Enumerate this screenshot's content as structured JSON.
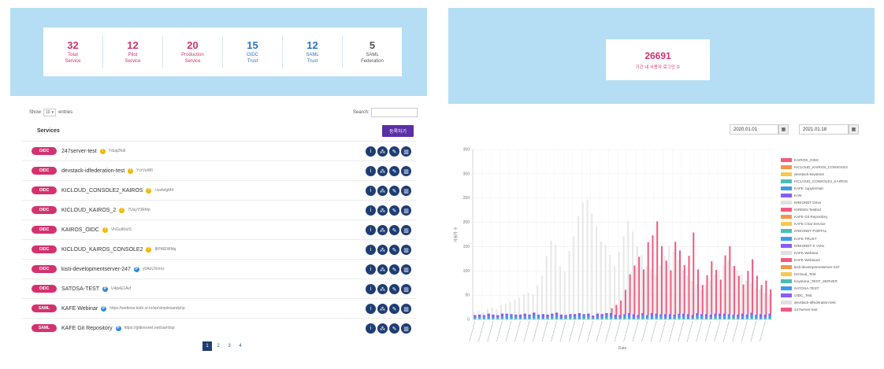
{
  "summary": {
    "stats": [
      {
        "value": "32",
        "line1": "Total",
        "line2": "Service",
        "color": "pink"
      },
      {
        "value": "12",
        "line1": "Pilot",
        "line2": "Service",
        "color": "pink"
      },
      {
        "value": "20",
        "line1": "Production",
        "line2": "Service",
        "color": "pink"
      },
      {
        "value": "15",
        "line1": "OIDC",
        "line2": "Trust",
        "color": "blue"
      },
      {
        "value": "12",
        "line1": "SAML",
        "line2": "Trust",
        "color": "blue"
      },
      {
        "value": "5",
        "line1": "SAML",
        "line2": "Federation",
        "color": "gray"
      }
    ]
  },
  "table": {
    "show_label": "Show",
    "entries_value": "10",
    "entries_label": "entries",
    "search_label": "Search:",
    "search_value": "",
    "header_label": "Services",
    "register_button": "등록하기",
    "rows": [
      {
        "type": "OIDC",
        "name": "247server-test",
        "status": "yellow",
        "id": "Yduq2Kdl"
      },
      {
        "type": "OIDC",
        "name": "devstack-idfederation-test",
        "status": "yellow",
        "id": "YcrVuWfi"
      },
      {
        "type": "OIDC",
        "name": "KICLOUD_CONSOLE2_KAIROS",
        "status": "yellow",
        "id": "l.wxfelgMrt"
      },
      {
        "type": "OIDC",
        "name": "KICLOUD_KAIROS_2",
        "status": "yellow",
        "id": "7UayY0Rhfp"
      },
      {
        "type": "OIDC",
        "name": "KAIROS_OIDC",
        "status": "yellow",
        "id": "VhGulKbzS"
      },
      {
        "type": "OIDC",
        "name": "KICLOUD_KAIROS_CONSOLE2",
        "status": "yellow",
        "id": "8iPWEWfdq"
      },
      {
        "type": "OIDC",
        "name": "kisti-developmentserver-247",
        "status": "blue",
        "id": "y0AeUXmnz"
      },
      {
        "type": "OIDC",
        "name": "SATOSA-TEST",
        "status": "blue",
        "id": "U4peE1Avf"
      },
      {
        "type": "SAML",
        "name": "KAFE Webinar",
        "status": "blue",
        "id": "https://webinar.kafe.or.kr/sp/simplesamlphp"
      },
      {
        "type": "SAML",
        "name": "KAFE Git Repository",
        "status": "blue",
        "id": "https://gitkreonet.net/saml/sp"
      }
    ],
    "pages": [
      "1",
      "2",
      "3",
      "4"
    ],
    "active_page": "1"
  },
  "login_summary": {
    "count": "26691",
    "label": "기간 내 사용자 로그인 수"
  },
  "date_range": {
    "start": "2020.01.01",
    "end": "2021.01.18"
  },
  "colors": {
    "pink": "#d4326f",
    "blue": "#2a73c9",
    "navy": "#1e3d73",
    "purple": "#5b2fa8",
    "panel": "#b5def4"
  },
  "chart_data": {
    "type": "bar",
    "stacked": true,
    "xlabel": "Date",
    "ylabel": "사용자 수",
    "ylim": [
      0,
      350
    ],
    "yticks": [
      0,
      50,
      100,
      150,
      200,
      250,
      300,
      350
    ],
    "grid": true,
    "legend_position": "right",
    "legend": [
      {
        "name": "KAIROS_OIDC",
        "color": "#f25a7f"
      },
      {
        "name": "KICLOUD_KAIROS_CONSOLE2",
        "color": "#f5954a"
      },
      {
        "name": "devstack-keystone",
        "color": "#f6c94e"
      },
      {
        "name": "KICLOUD_CONSOLE2_KAIROS",
        "color": "#4bbfb3"
      },
      {
        "name": "KAFE JupyterHub",
        "color": "#3d9be9"
      },
      {
        "name": "KAN",
        "color": "#8a5cf0"
      },
      {
        "name": "KREONET Drive",
        "color": "#e0e0e0"
      },
      {
        "name": "IOREEN Testbrd",
        "color": "#f25a7f"
      },
      {
        "name": "KAFE Git Repository",
        "color": "#f5954a"
      },
      {
        "name": "KAFE Chat Service",
        "color": "#f6c94e"
      },
      {
        "name": "KREONET PORTAL",
        "color": "#4bbfb3"
      },
      {
        "name": "KAFE TRUST",
        "color": "#3d9be9"
      },
      {
        "name": "KREONET-S VON",
        "color": "#8a5cf0"
      },
      {
        "name": "KAFE Webinar",
        "color": "#e0e0e0"
      },
      {
        "name": "KAFE Webinar2",
        "color": "#f25a7f"
      },
      {
        "name": "kisti-developmentserver-247",
        "color": "#f5954a"
      },
      {
        "name": "KICloud_Test",
        "color": "#f6c94e"
      },
      {
        "name": "Keystone_TEST_SERVER",
        "color": "#4bbfb3"
      },
      {
        "name": "SATOSA-TEST",
        "color": "#3d9be9"
      },
      {
        "name": "OIDC_Test",
        "color": "#8a5cf0"
      },
      {
        "name": "devstack-idfederation-test",
        "color": "#e0e0e0"
      },
      {
        "name": "247server-test",
        "color": "#f25a7f"
      }
    ],
    "series": [
      {
        "name": "KREONET Drive",
        "color": "#e6e6e6",
        "values": [
          5,
          8,
          6,
          10,
          15,
          12,
          18,
          20,
          25,
          30,
          35,
          40,
          45,
          38,
          60,
          80,
          120,
          150,
          140,
          100,
          90,
          130,
          160,
          200,
          230,
          235,
          210,
          180,
          150,
          140,
          120,
          100,
          130,
          160,
          190,
          170,
          140,
          120,
          100,
          90,
          80,
          100,
          120,
          140,
          130,
          110,
          90,
          80,
          70,
          60,
          50,
          60,
          70,
          80,
          90,
          100,
          110,
          100,
          90,
          80,
          70,
          60,
          55,
          50,
          45,
          40
        ]
      },
      {
        "name": "KAIROS_OIDC",
        "color": "#f25a7f",
        "values": [
          0,
          0,
          0,
          0,
          0,
          0,
          0,
          0,
          0,
          0,
          0,
          0,
          0,
          0,
          0,
          0,
          0,
          0,
          0,
          0,
          0,
          0,
          0,
          0,
          0,
          0,
          0,
          0,
          0,
          0,
          10,
          20,
          30,
          50,
          80,
          100,
          120,
          90,
          150,
          160,
          190,
          140,
          110,
          90,
          150,
          130,
          100,
          120,
          170,
          90,
          60,
          80,
          110,
          90,
          70,
          120,
          140,
          100,
          80,
          60,
          90,
          110,
          80,
          60,
          70,
          50
        ]
      },
      {
        "name": "SATOSA-TEST",
        "color": "#3d9be9",
        "values": [
          3,
          2,
          4,
          5,
          3,
          2,
          4,
          6,
          5,
          4,
          3,
          5,
          4,
          6,
          5,
          4,
          3,
          5,
          6,
          4,
          3,
          5,
          4,
          6,
          5,
          4,
          3,
          5,
          4,
          6,
          5,
          4,
          3,
          5,
          6,
          4,
          3,
          5,
          4,
          6,
          5,
          4,
          3,
          5,
          4,
          6,
          5,
          4,
          3,
          5,
          6,
          4,
          3,
          5,
          4,
          6,
          5,
          4,
          3,
          5,
          4,
          6,
          5,
          4,
          3,
          5
        ]
      },
      {
        "name": "OIDC_Test",
        "color": "#8a5cf0",
        "values": [
          4,
          5,
          3,
          6,
          5,
          4,
          6,
          5,
          4,
          3,
          5,
          6,
          4,
          5,
          3,
          6,
          5,
          4,
          6,
          5,
          4,
          3,
          5,
          6,
          4,
          5,
          3,
          6,
          5,
          4,
          6,
          5,
          4,
          3,
          5,
          6,
          4,
          5,
          3,
          6,
          5,
          4,
          6,
          5,
          4,
          3,
          5,
          6,
          4,
          5,
          3,
          6,
          5,
          4,
          6,
          5,
          4,
          3,
          5,
          6,
          4,
          5,
          3,
          6,
          5,
          4
        ]
      },
      {
        "name": "KICLOUD_CONSOLE2_KAIROS",
        "color": "#4bbfb3",
        "values": [
          2,
          3,
          2,
          1,
          2,
          3,
          2,
          1,
          2,
          3,
          2,
          1,
          2,
          3,
          2,
          1,
          2,
          3,
          2,
          1,
          2,
          3,
          2,
          1,
          2,
          3,
          2,
          1,
          2,
          3,
          2,
          1,
          2,
          3,
          2,
          1,
          2,
          3,
          2,
          1,
          2,
          3,
          2,
          1,
          2,
          3,
          2,
          1,
          2,
          3,
          2,
          1,
          2,
          3,
          2,
          1,
          2,
          3,
          2,
          1,
          2,
          3,
          2,
          1,
          2,
          3
        ]
      }
    ]
  }
}
